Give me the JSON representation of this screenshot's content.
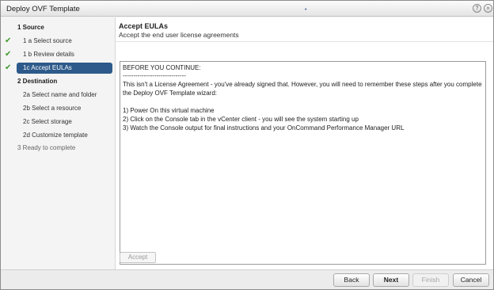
{
  "window": {
    "title": "Deploy OVF Template",
    "help_icon": "help-icon",
    "expand_icon": "expand-icon"
  },
  "steps": [
    {
      "id": "1",
      "label": "1  Source",
      "type": "group",
      "done": false
    },
    {
      "id": "1a",
      "label": "1 a  Select source",
      "type": "sub",
      "done": true
    },
    {
      "id": "1b",
      "label": "1 b  Review details",
      "type": "sub",
      "done": true
    },
    {
      "id": "1c",
      "label": "1c  Accept EULAs",
      "type": "sub",
      "done": true,
      "selected": true
    },
    {
      "id": "2",
      "label": "2  Destination",
      "type": "group",
      "done": false
    },
    {
      "id": "2a",
      "label": "2a  Select name and folder",
      "type": "sub",
      "done": false
    },
    {
      "id": "2b",
      "label": "2b  Select a resource",
      "type": "sub",
      "done": false
    },
    {
      "id": "2c",
      "label": "2c  Select storage",
      "type": "sub",
      "done": false
    },
    {
      "id": "2d",
      "label": "2d  Customize template",
      "type": "sub",
      "done": false
    },
    {
      "id": "3",
      "label": "3  Ready to complete",
      "type": "group",
      "done": false,
      "inactive": true
    }
  ],
  "main": {
    "title": "Accept EULAs",
    "subtitle": "Accept the end user license agreements",
    "eula_lines": [
      "BEFORE YOU CONTINUE:",
      "------------------------------",
      "This isn't a License Agreement - you've already signed that. However, you will need to remember these steps after you complete",
      "the Deploy OVF Template wizard:",
      "",
      "1) Power On this virtual machine",
      "2) Click on the Console tab in the vCenter client - you will see the system starting up",
      "3) Watch the Console output for final instructions and your OnCommand Performance Manager URL"
    ],
    "accept_label": "Accept"
  },
  "footer": {
    "back_label": "Back",
    "next_label": "Next",
    "finish_label": "Finish",
    "cancel_label": "Cancel"
  },
  "colors": {
    "selected_step": "#2d5a8a",
    "check": "#3f9a2d"
  }
}
